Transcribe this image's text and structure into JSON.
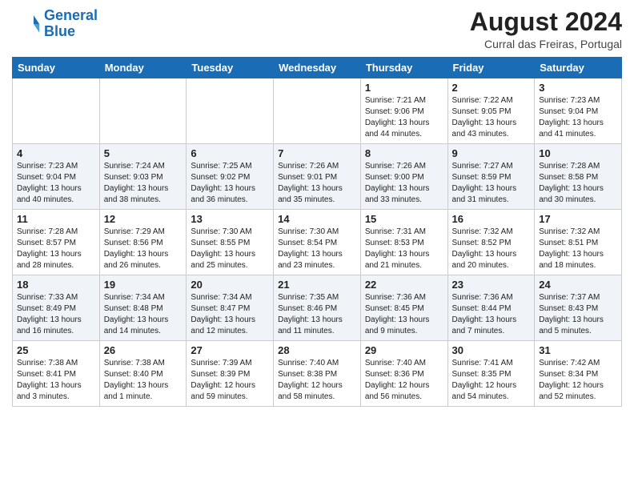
{
  "header": {
    "logo_line1": "General",
    "logo_line2": "Blue",
    "month_year": "August 2024",
    "location": "Curral das Freiras, Portugal"
  },
  "weekdays": [
    "Sunday",
    "Monday",
    "Tuesday",
    "Wednesday",
    "Thursday",
    "Friday",
    "Saturday"
  ],
  "weeks": [
    [
      {
        "day": "",
        "info": ""
      },
      {
        "day": "",
        "info": ""
      },
      {
        "day": "",
        "info": ""
      },
      {
        "day": "",
        "info": ""
      },
      {
        "day": "1",
        "info": "Sunrise: 7:21 AM\nSunset: 9:06 PM\nDaylight: 13 hours\nand 44 minutes."
      },
      {
        "day": "2",
        "info": "Sunrise: 7:22 AM\nSunset: 9:05 PM\nDaylight: 13 hours\nand 43 minutes."
      },
      {
        "day": "3",
        "info": "Sunrise: 7:23 AM\nSunset: 9:04 PM\nDaylight: 13 hours\nand 41 minutes."
      }
    ],
    [
      {
        "day": "4",
        "info": "Sunrise: 7:23 AM\nSunset: 9:04 PM\nDaylight: 13 hours\nand 40 minutes."
      },
      {
        "day": "5",
        "info": "Sunrise: 7:24 AM\nSunset: 9:03 PM\nDaylight: 13 hours\nand 38 minutes."
      },
      {
        "day": "6",
        "info": "Sunrise: 7:25 AM\nSunset: 9:02 PM\nDaylight: 13 hours\nand 36 minutes."
      },
      {
        "day": "7",
        "info": "Sunrise: 7:26 AM\nSunset: 9:01 PM\nDaylight: 13 hours\nand 35 minutes."
      },
      {
        "day": "8",
        "info": "Sunrise: 7:26 AM\nSunset: 9:00 PM\nDaylight: 13 hours\nand 33 minutes."
      },
      {
        "day": "9",
        "info": "Sunrise: 7:27 AM\nSunset: 8:59 PM\nDaylight: 13 hours\nand 31 minutes."
      },
      {
        "day": "10",
        "info": "Sunrise: 7:28 AM\nSunset: 8:58 PM\nDaylight: 13 hours\nand 30 minutes."
      }
    ],
    [
      {
        "day": "11",
        "info": "Sunrise: 7:28 AM\nSunset: 8:57 PM\nDaylight: 13 hours\nand 28 minutes."
      },
      {
        "day": "12",
        "info": "Sunrise: 7:29 AM\nSunset: 8:56 PM\nDaylight: 13 hours\nand 26 minutes."
      },
      {
        "day": "13",
        "info": "Sunrise: 7:30 AM\nSunset: 8:55 PM\nDaylight: 13 hours\nand 25 minutes."
      },
      {
        "day": "14",
        "info": "Sunrise: 7:30 AM\nSunset: 8:54 PM\nDaylight: 13 hours\nand 23 minutes."
      },
      {
        "day": "15",
        "info": "Sunrise: 7:31 AM\nSunset: 8:53 PM\nDaylight: 13 hours\nand 21 minutes."
      },
      {
        "day": "16",
        "info": "Sunrise: 7:32 AM\nSunset: 8:52 PM\nDaylight: 13 hours\nand 20 minutes."
      },
      {
        "day": "17",
        "info": "Sunrise: 7:32 AM\nSunset: 8:51 PM\nDaylight: 13 hours\nand 18 minutes."
      }
    ],
    [
      {
        "day": "18",
        "info": "Sunrise: 7:33 AM\nSunset: 8:49 PM\nDaylight: 13 hours\nand 16 minutes."
      },
      {
        "day": "19",
        "info": "Sunrise: 7:34 AM\nSunset: 8:48 PM\nDaylight: 13 hours\nand 14 minutes."
      },
      {
        "day": "20",
        "info": "Sunrise: 7:34 AM\nSunset: 8:47 PM\nDaylight: 13 hours\nand 12 minutes."
      },
      {
        "day": "21",
        "info": "Sunrise: 7:35 AM\nSunset: 8:46 PM\nDaylight: 13 hours\nand 11 minutes."
      },
      {
        "day": "22",
        "info": "Sunrise: 7:36 AM\nSunset: 8:45 PM\nDaylight: 13 hours\nand 9 minutes."
      },
      {
        "day": "23",
        "info": "Sunrise: 7:36 AM\nSunset: 8:44 PM\nDaylight: 13 hours\nand 7 minutes."
      },
      {
        "day": "24",
        "info": "Sunrise: 7:37 AM\nSunset: 8:43 PM\nDaylight: 13 hours\nand 5 minutes."
      }
    ],
    [
      {
        "day": "25",
        "info": "Sunrise: 7:38 AM\nSunset: 8:41 PM\nDaylight: 13 hours\nand 3 minutes."
      },
      {
        "day": "26",
        "info": "Sunrise: 7:38 AM\nSunset: 8:40 PM\nDaylight: 13 hours\nand 1 minute."
      },
      {
        "day": "27",
        "info": "Sunrise: 7:39 AM\nSunset: 8:39 PM\nDaylight: 12 hours\nand 59 minutes."
      },
      {
        "day": "28",
        "info": "Sunrise: 7:40 AM\nSunset: 8:38 PM\nDaylight: 12 hours\nand 58 minutes."
      },
      {
        "day": "29",
        "info": "Sunrise: 7:40 AM\nSunset: 8:36 PM\nDaylight: 12 hours\nand 56 minutes."
      },
      {
        "day": "30",
        "info": "Sunrise: 7:41 AM\nSunset: 8:35 PM\nDaylight: 12 hours\nand 54 minutes."
      },
      {
        "day": "31",
        "info": "Sunrise: 7:42 AM\nSunset: 8:34 PM\nDaylight: 12 hours\nand 52 minutes."
      }
    ]
  ]
}
